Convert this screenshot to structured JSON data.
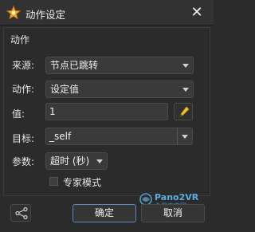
{
  "window": {
    "title": "动作设定"
  },
  "group": {
    "title": "动作"
  },
  "fields": {
    "source_label": "来源:",
    "source_value": "节点已跳转",
    "action_label": "动作:",
    "action_value": "设定值",
    "value_label": "值:",
    "value_value": "1",
    "target_label": "目标:",
    "target_value": "_self",
    "param_label": "参数:",
    "param_value": "超时 (秒)"
  },
  "expert_mode": {
    "label": "专家模式",
    "checked": false
  },
  "buttons": {
    "ok": "确定",
    "cancel": "取消"
  },
  "watermark": {
    "brand": "Pano2VR",
    "sub": "全景中文网"
  },
  "colors": {
    "accent_border": "#5b87c5",
    "pencil": "#f2c230",
    "background": "#2b2b2b"
  }
}
